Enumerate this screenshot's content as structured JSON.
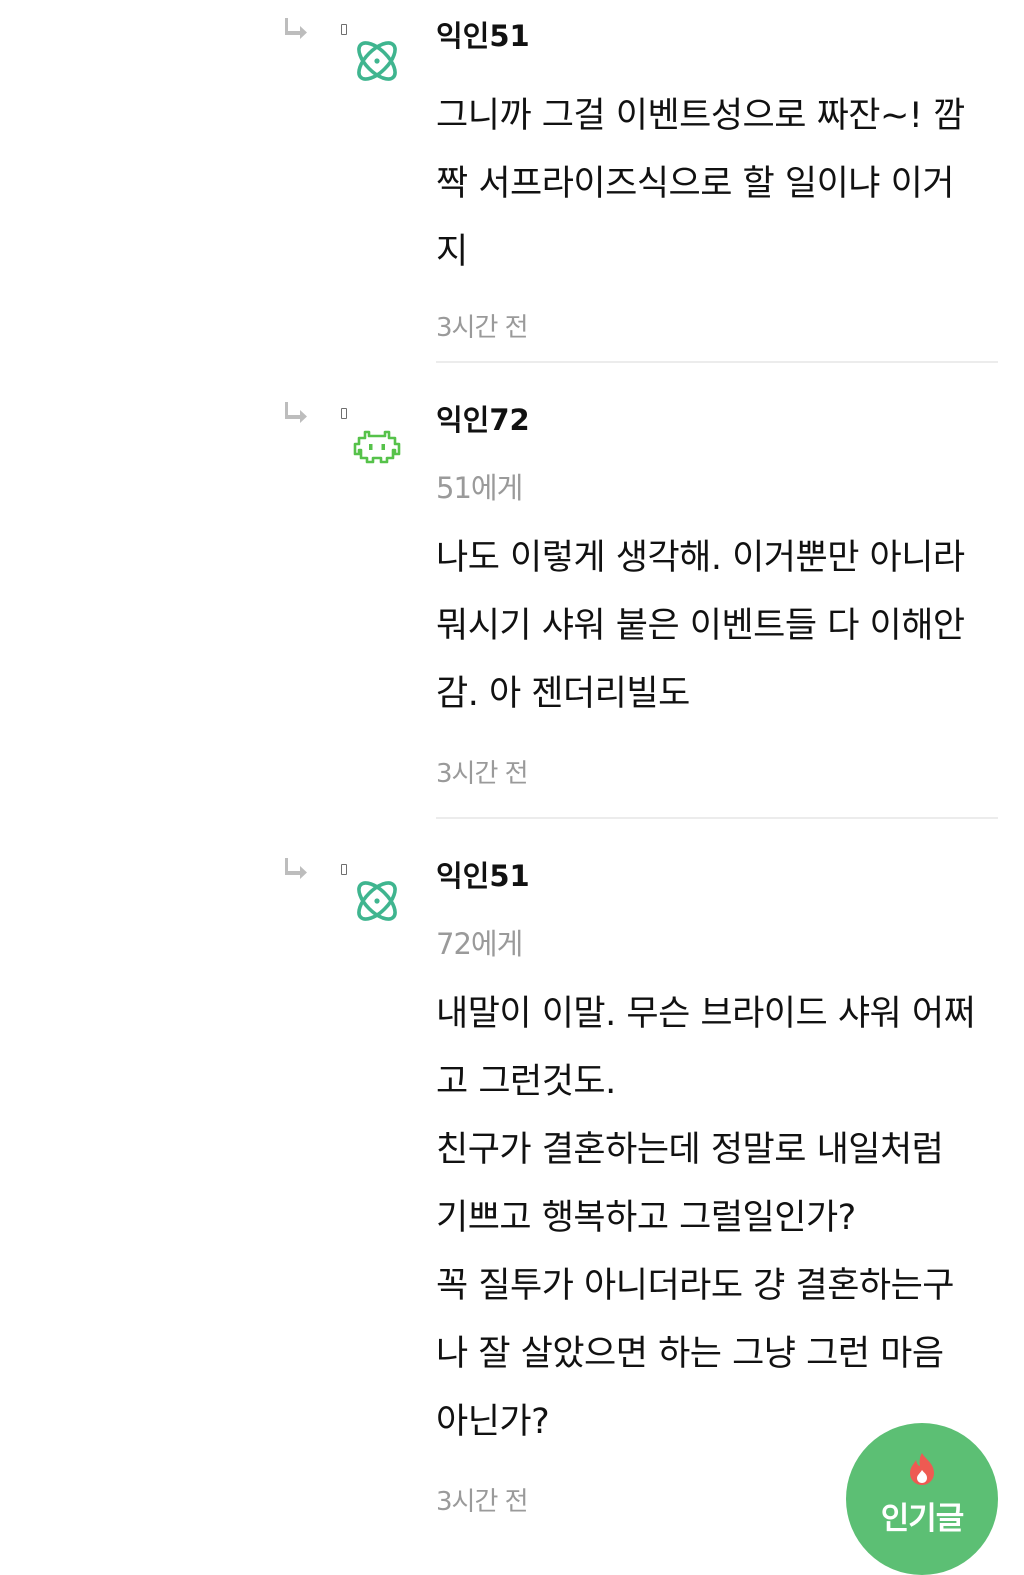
{
  "comments": [
    {
      "author": "익인51",
      "avatar_icon": "atom-icon",
      "target": "",
      "body_lines": [
        "그니까 그걸 이벤트성으로 짜잔~! 깜",
        "짝 서프라이즈식으로 할 일이냐 이거",
        "지"
      ],
      "time": "3시간 전"
    },
    {
      "author": "익인72",
      "avatar_icon": "space-invader-icon",
      "target": "51에게",
      "body_lines": [
        "나도 이렇게 생각해. 이거뿐만 아니라",
        "뭐시기 샤워 붙은 이벤트들 다 이해안",
        "감. 아 젠더리빌도"
      ],
      "time": "3시간 전"
    },
    {
      "author": "익인51",
      "avatar_icon": "atom-icon",
      "target": "72에게",
      "body_lines": [
        "내말이 이말. 무슨 브라이드 샤워 어쩌",
        "고 그런것도.",
        "친구가 결혼하는데 정말로 내일처럼",
        "기쁘고 행복하고 그럴일인가?",
        "꼭 질투가 아니더라도 걍 결혼하는구",
        "나 잘 살았으면 하는 그냥 그런 마음",
        "아닌가?"
      ],
      "time": "3시간 전"
    }
  ],
  "popular_button": {
    "label": "인기글",
    "icon": "flame-icon"
  },
  "colors": {
    "accent_green": "#5cbf74",
    "avatar_teal": "#3fb58f",
    "avatar_green": "#56c24a",
    "muted_text": "#9a9a9a",
    "flame_red": "#ee5a52"
  }
}
